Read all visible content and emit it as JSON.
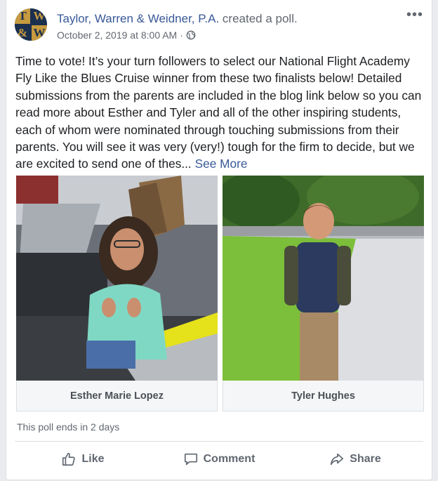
{
  "post": {
    "author": "Taylor, Warren & Weidner, P.A.",
    "action_text": "created a poll.",
    "timestamp": "October 2, 2019 at 8:00 AM",
    "separator": "·",
    "privacy_icon": "globe-icon",
    "more_label": "•••",
    "logo_letters": [
      "T",
      "W",
      "&",
      "W"
    ],
    "text": "Time to vote! It’s your turn followers to select our National Flight Academy Fly Like the Blues Cruise winner from these two finalists below! Detailed submissions from the parents are included in the blog link below so you can read more about Esther and Tyler and all of the other inspiring students, each of whom were nominated through touching submissions from their parents. You will see it was very (very!) tough for the firm to decide, but we are excited to send one of thes...",
    "see_more": "See More"
  },
  "poll": {
    "options": [
      {
        "label": "Esther Marie Lopez"
      },
      {
        "label": "Tyler Hughes"
      }
    ],
    "ends_text": "This poll ends in 2 days"
  },
  "actions": {
    "like": "Like",
    "comment": "Comment",
    "share": "Share"
  },
  "colors": {
    "link": "#385898",
    "secondary_text": "#616770",
    "logo_navy": "#1b2f4f",
    "logo_gold": "#c69a3f"
  }
}
